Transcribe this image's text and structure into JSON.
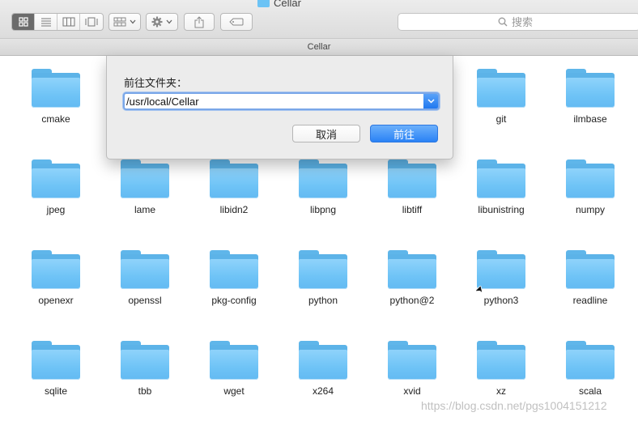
{
  "window": {
    "title": "Cellar"
  },
  "toolbar": {
    "view_modes": [
      {
        "name": "icon-view",
        "icon": "grid-icon",
        "active": true
      },
      {
        "name": "list-view",
        "icon": "list-icon",
        "active": false
      },
      {
        "name": "column-view",
        "icon": "columns-icon",
        "active": false
      },
      {
        "name": "gallery-view",
        "icon": "gallery-icon",
        "active": false
      }
    ],
    "group_icon": "group-by-icon",
    "action_icon": "gear-icon",
    "share_icon": "share-icon",
    "tag_icon": "tag-icon",
    "search_placeholder": "搜索"
  },
  "pathbar": {
    "label": "Cellar"
  },
  "folders": [
    {
      "name": "cmake"
    },
    {
      "name": ""
    },
    {
      "name": ""
    },
    {
      "name": ""
    },
    {
      "name": ""
    },
    {
      "name": "git"
    },
    {
      "name": "ilmbase"
    },
    {
      "name": "jpeg"
    },
    {
      "name": "lame"
    },
    {
      "name": "libidn2"
    },
    {
      "name": "libpng"
    },
    {
      "name": "libtiff"
    },
    {
      "name": "libunistring"
    },
    {
      "name": "numpy"
    },
    {
      "name": "openexr"
    },
    {
      "name": "openssl"
    },
    {
      "name": "pkg-config"
    },
    {
      "name": "python"
    },
    {
      "name": "python@2"
    },
    {
      "name": "python3"
    },
    {
      "name": "readline"
    },
    {
      "name": "sqlite"
    },
    {
      "name": "tbb"
    },
    {
      "name": "wget"
    },
    {
      "name": "x264"
    },
    {
      "name": "xvid"
    },
    {
      "name": "xz"
    },
    {
      "name": "scala"
    }
  ],
  "dialog": {
    "title": "前往文件夹：",
    "path_value": "/usr/local/Cellar",
    "cancel_label": "取消",
    "go_label": "前往"
  },
  "watermark": "https://blog.csdn.net/pgs1004151212",
  "colors": {
    "folder": "#6ec3f6",
    "accent": "#2a82f5"
  }
}
